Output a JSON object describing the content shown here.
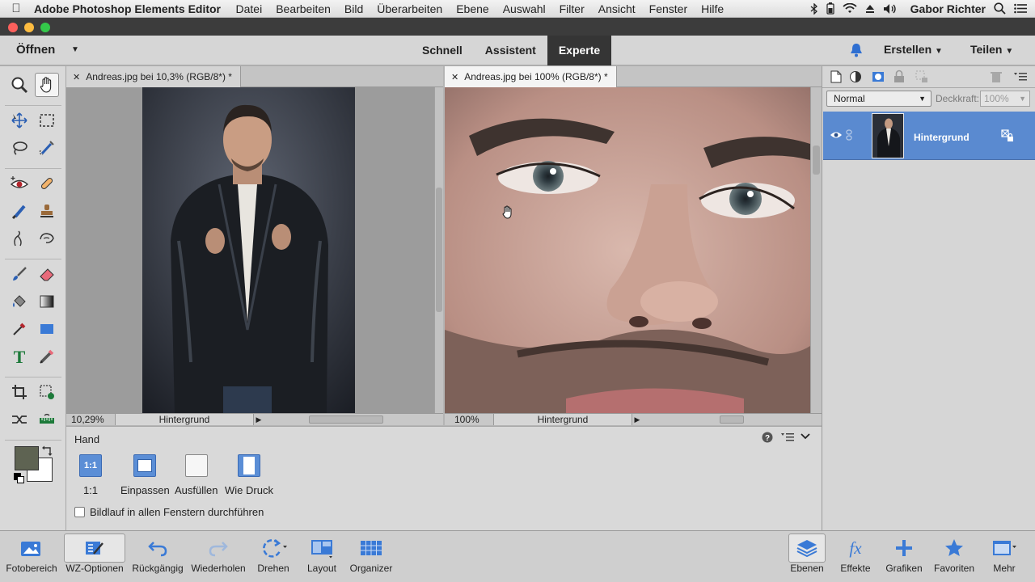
{
  "menubar": {
    "app_name": "Adobe Photoshop Elements Editor",
    "items": [
      "Datei",
      "Bearbeiten",
      "Bild",
      "Überarbeiten",
      "Ebene",
      "Auswahl",
      "Filter",
      "Ansicht",
      "Fenster",
      "Hilfe"
    ],
    "user": "Gabor Richter"
  },
  "topbar": {
    "open_label": "Öffnen",
    "modes": [
      "Schnell",
      "Assistent",
      "Experte"
    ],
    "active_mode": "Experte",
    "create_label": "Erstellen",
    "share_label": "Teilen"
  },
  "documents": [
    {
      "tab_title": "Andreas.jpg bei 10,3% (RGB/8*) *",
      "zoom": "10,29%",
      "layer": "Hintergrund"
    },
    {
      "tab_title": "Andreas.jpg bei 100% (RGB/8*) *",
      "zoom": "100%",
      "layer": "Hintergrund"
    }
  ],
  "tool_options": {
    "title": "Hand",
    "buttons": [
      {
        "label": "1:1",
        "icon_text": "1:1"
      },
      {
        "label": "Einpassen"
      },
      {
        "label": "Ausfüllen"
      },
      {
        "label": "Wie Druck"
      }
    ],
    "checkbox_label": "Bildlauf in allen Fenstern durchführen",
    "checkbox_checked": false
  },
  "layers_panel": {
    "blend_mode": "Normal",
    "opacity_label": "Deckkraft:",
    "opacity_value": "100%",
    "layers": [
      {
        "name": "Hintergrund",
        "visible": true,
        "selected": true
      }
    ]
  },
  "colors": {
    "foreground": "#5e6352",
    "background": "#ffffff",
    "selection_blue": "#5a8ad0"
  },
  "bottombar": {
    "left": [
      "Fotobereich",
      "WZ-Optionen",
      "Rückgängig",
      "Wiederholen",
      "Drehen",
      "Layout",
      "Organizer"
    ],
    "right": [
      "Ebenen",
      "Effekte",
      "Grafiken",
      "Favoriten",
      "Mehr"
    ]
  }
}
